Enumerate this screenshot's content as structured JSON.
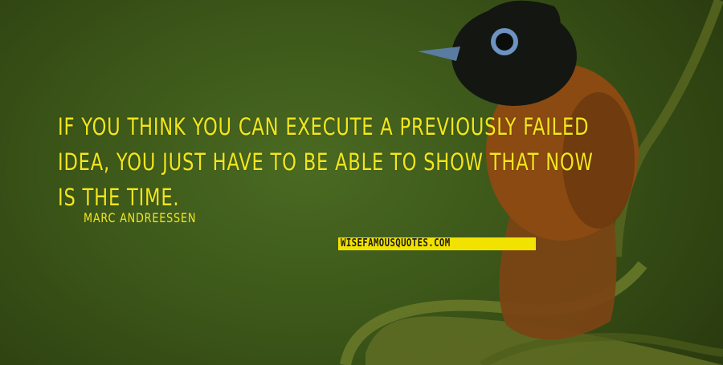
{
  "quote": {
    "lines": [
      "IF YOU THINK YOU CAN EXECUTE A PREVIOUSLY FAILED",
      "IDEA, YOU JUST HAVE TO BE ABLE TO SHOW THAT NOW",
      "IS THE TIME."
    ],
    "author": "MARC ANDREESSEN"
  },
  "watermark": {
    "text": "WISEFAMOUSQUOTES.COM"
  },
  "background": {
    "subject": "bird-on-branch-photo",
    "colors": {
      "bg": "#3c5719",
      "text": "#f2e61c",
      "watermark_bg": "#f2e200"
    }
  }
}
